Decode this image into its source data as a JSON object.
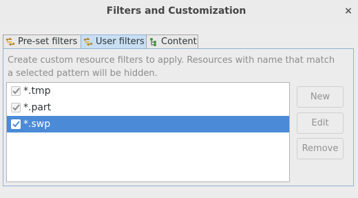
{
  "window": {
    "title": "Filters and Customization",
    "close_glyph": "×"
  },
  "tabs": [
    {
      "label": "Pre-set filters",
      "icon": "filter-icon",
      "active": false
    },
    {
      "label": "User filters",
      "icon": "filter-icon",
      "active": true
    },
    {
      "label": "Content",
      "icon": "content-tree-icon",
      "active": false
    }
  ],
  "user_filters": {
    "description": "Create custom resource filters to apply. Resources with name that match a selected pattern will be hidden.",
    "filters": [
      {
        "pattern": "*.tmp",
        "checked": true,
        "selected": false
      },
      {
        "pattern": "*.part",
        "checked": true,
        "selected": false
      },
      {
        "pattern": "*.swp",
        "checked": true,
        "selected": true
      }
    ],
    "buttons": {
      "new_label": "New",
      "edit_label": "Edit",
      "remove_label": "Remove",
      "enabled": false
    }
  },
  "colors": {
    "selection": "#4a8ad6",
    "active_tab": "#c8dff3",
    "panel_border": "#8fb2d2"
  }
}
